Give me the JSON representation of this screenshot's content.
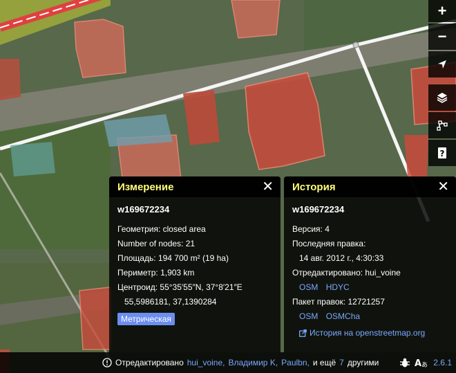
{
  "map_controls": {
    "zoom_in": "+",
    "zoom_out": "−",
    "locate_icon": "location-arrow-icon",
    "layers_icon": "layers-icon",
    "map_data_icon": "map-data-icon",
    "help_icon": "help-icon"
  },
  "measurement_panel": {
    "title": "Измерение",
    "entity_id": "w169672234",
    "geometry_label": "Геометрия:",
    "geometry_value": "closed area",
    "nodes_label": "Number of nodes:",
    "nodes_value": "21",
    "area_label": "Площадь:",
    "area_value": "194 700 m² (19 ha)",
    "perimeter_label": "Периметр:",
    "perimeter_value": "1,903 km",
    "centroid_label": "Центроид:",
    "centroid_value": "55°35′55″N, 37°8′21″E",
    "centroid_decimal": "55,5986181, 37,1390284",
    "unit_toggle": "Метрическая"
  },
  "history_panel": {
    "title": "История",
    "entity_id": "w169672234",
    "version_label": "Версия:",
    "version_value": "4",
    "last_edit_label": "Последняя правка:",
    "last_edit_value": "14 авг. 2012 г., 4:30:33",
    "edited_by_label": "Отредактировано:",
    "edited_by_value": "hui_voine",
    "user_links": [
      "OSM",
      "HDYC"
    ],
    "changeset_label": "Пакет правок:",
    "changeset_value": "12721257",
    "changeset_links": [
      "OSM",
      "OSMCha"
    ],
    "external_link": "История на openstreetmap.org"
  },
  "footer": {
    "prefix": "Отредактировано",
    "users": [
      "hui_voine,",
      "Владимир K,",
      "Paulbn,"
    ],
    "and_more": "и ещё",
    "more_count": "7",
    "others": "другими",
    "version": "2.6.1"
  },
  "colors": {
    "accent_title": "#ffff7a",
    "link": "#7aa8ff",
    "badge": "#6b8ef0"
  }
}
